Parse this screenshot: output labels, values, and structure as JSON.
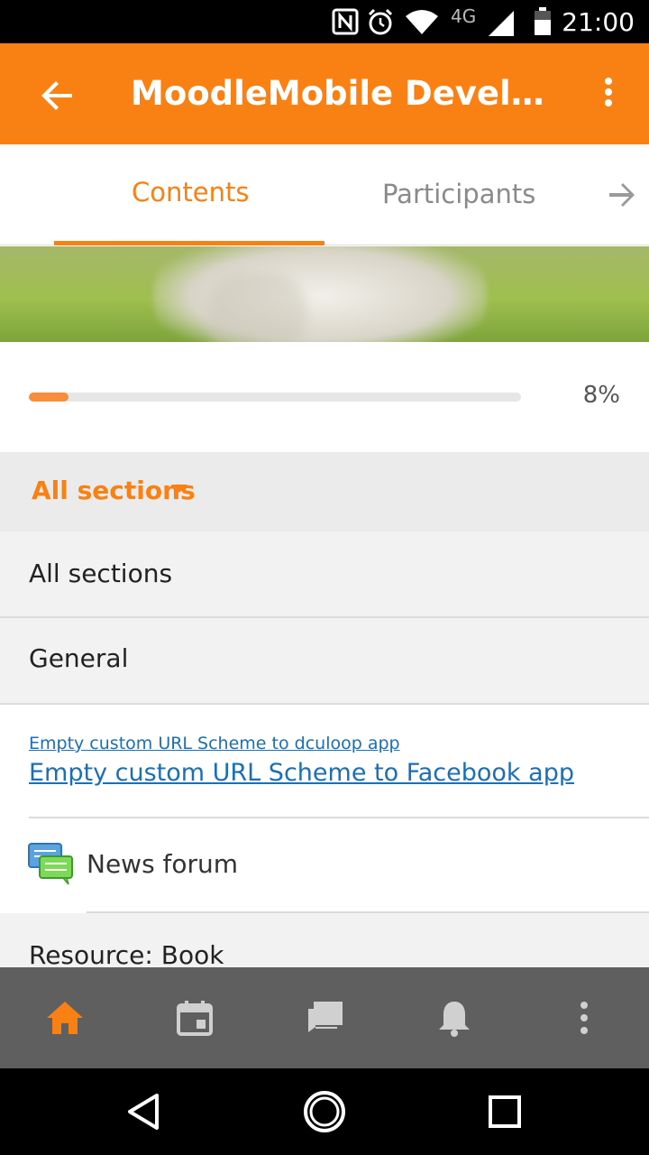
{
  "status_bar": {
    "time": "21:00",
    "network": "4G",
    "icons": [
      "nfc-icon",
      "alarm-icon",
      "wifi-icon",
      "signal-icon",
      "battery-icon"
    ]
  },
  "app_bar": {
    "title": "MoodleMobile Develope...",
    "back_icon": "arrow-left-icon",
    "menu_icon": "more-vert-icon",
    "color": "#f98012"
  },
  "tabs": {
    "items": [
      {
        "label": "Contents",
        "active": true
      },
      {
        "label": "Participants",
        "active": false
      }
    ],
    "next_icon": "arrow-right-icon"
  },
  "progress": {
    "value": 0.08,
    "label": "8%"
  },
  "section_selector": {
    "label": "All sections"
  },
  "dropdown": {
    "options": [
      "All sections",
      "General"
    ]
  },
  "links": {
    "small": "Empty custom URL Scheme to dculoop app",
    "large": "Empty custom URL Scheme to Facebook app"
  },
  "forum": {
    "label": "News forum",
    "icon": "forum-icon"
  },
  "resource": {
    "label": "Resource: Book"
  },
  "bottom_tabs": {
    "items": [
      "home-icon",
      "calendar-icon",
      "messages-icon",
      "notifications-icon",
      "more-vert-icon"
    ],
    "active_color": "#f98012",
    "inactive_color": "#d0d0d0"
  },
  "system_nav": {
    "items": [
      "back-triangle-icon",
      "home-circle-icon",
      "recents-square-icon"
    ]
  }
}
